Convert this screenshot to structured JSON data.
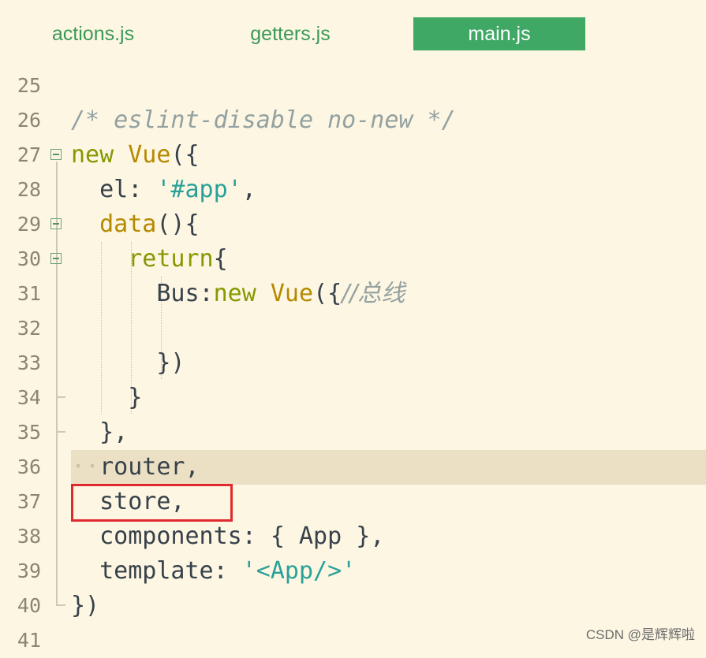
{
  "tabs": [
    {
      "label": "actions.js",
      "active": false
    },
    {
      "label": "getters.js",
      "active": false
    },
    {
      "label": "main.js",
      "active": true
    }
  ],
  "lines": {
    "l25": {
      "num": "25"
    },
    "l26": {
      "num": "26",
      "comment": "/* eslint-disable no-new */"
    },
    "l27": {
      "num": "27",
      "kw_new": "new",
      "cls": "Vue",
      "punct": "({"
    },
    "l28": {
      "num": "28",
      "prefix": "  el: ",
      "str": "'#app'",
      "suffix": ","
    },
    "l29": {
      "num": "29",
      "prefix": "  ",
      "fn": "data",
      "suffix": "(){"
    },
    "l30": {
      "num": "30",
      "prefix": "    ",
      "kw": "return",
      "suffix": "{"
    },
    "l31": {
      "num": "31",
      "prefix": "      Bus:",
      "kw_new": "new",
      "cls": "Vue",
      "punct": "({",
      "comment": "//总线"
    },
    "l32": {
      "num": "32"
    },
    "l33": {
      "num": "33",
      "text": "      })"
    },
    "l34": {
      "num": "34",
      "text": "    }"
    },
    "l35": {
      "num": "35",
      "text": "  },"
    },
    "l36": {
      "num": "36",
      "text": "router,"
    },
    "l37": {
      "num": "37",
      "text": "  store,"
    },
    "l38": {
      "num": "38",
      "text": "  components: { App },"
    },
    "l39": {
      "num": "39",
      "prefix": "  template: ",
      "str": "'<App/>'"
    },
    "l40": {
      "num": "40",
      "text": "})"
    },
    "l41": {
      "num": "41"
    }
  },
  "watermark": "CSDN @是辉辉啦",
  "colors": {
    "background": "#fdf6e3",
    "active_tab": "#3fa864",
    "keyword": "#859900",
    "class_name": "#b58900",
    "string": "#2aa198",
    "highlight_box": "#e0292f"
  }
}
